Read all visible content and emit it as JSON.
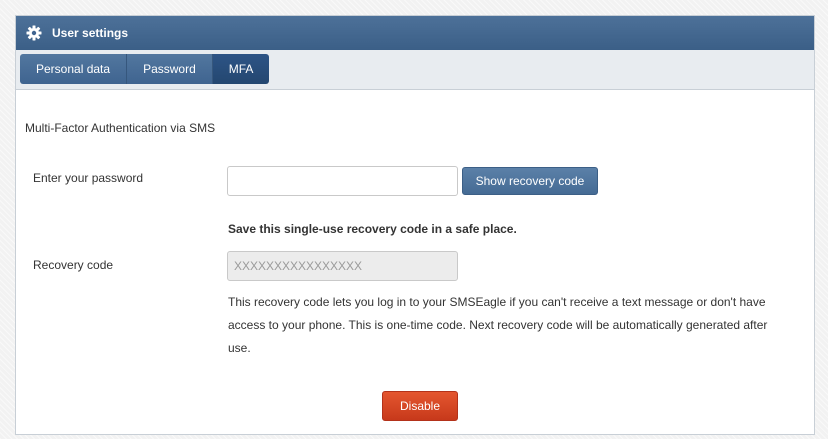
{
  "panel": {
    "title": "User settings",
    "icon": "gear-icon"
  },
  "tabs": [
    {
      "label": "Personal data",
      "active": false
    },
    {
      "label": "Password",
      "active": false
    },
    {
      "label": "MFA",
      "active": true
    }
  ],
  "mfa": {
    "section_title": "Multi-Factor Authentication via SMS",
    "password_label": "Enter your password",
    "password_value": "",
    "show_recovery_button": "Show recovery code",
    "notice": "Save this single-use recovery code in a safe place.",
    "recovery_label": "Recovery code",
    "recovery_value": "XXXXXXXXXXXXXXXX",
    "help_text": "This recovery code lets you log in to your SMSEagle if you can't receive a text message or don't have access to your phone. This is one-time code. Next recovery code will be automatically generated after use.",
    "disable_button": "Disable"
  },
  "colors": {
    "header": "#3b5f87",
    "tab_active": "#2d5486",
    "button_blue": "#456b94",
    "button_red": "#d9442a"
  }
}
